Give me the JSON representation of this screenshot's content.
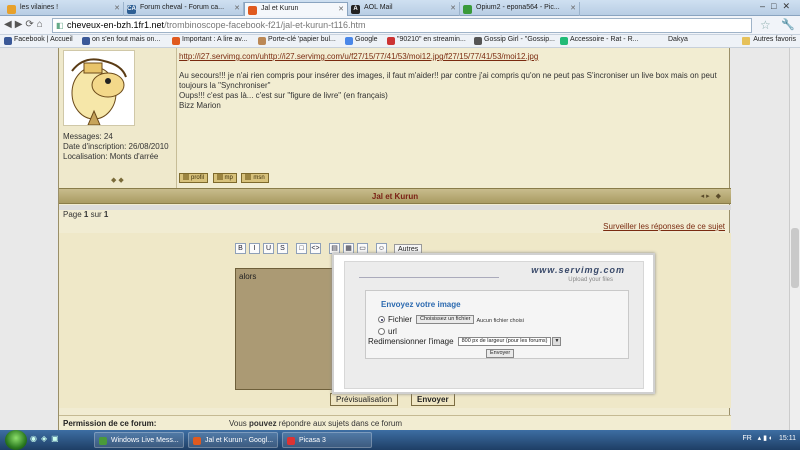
{
  "browser": {
    "tabs": [
      {
        "label": "les vilaines !",
        "icon": "ball-icon",
        "color": "#e7a12b",
        "active": false
      },
      {
        "label": "Forum cheval - Forum ca...",
        "icon": "ca-icon",
        "color": "#2e5f94",
        "active": false
      },
      {
        "label": "Jal et Kurun",
        "icon": "forum-icon",
        "color": "#e05a1f",
        "active": true
      },
      {
        "label": "AOL Mail",
        "icon": "aol-icon",
        "color": "#222222",
        "active": false
      },
      {
        "label": "Opium2 - epona564 - Pic...",
        "icon": "picasa-icon",
        "color": "#3a9a3a",
        "active": false
      }
    ],
    "address": {
      "host": "cheveux-en-bzh.1fr1.net",
      "path": "/trombinoscope-facebook-f21/jal-et-kurun-t116.htm"
    },
    "bookmarks": [
      {
        "label": "Facebook | Accueil",
        "color": "#3b5998"
      },
      {
        "label": "on s'en fout mais on...",
        "color": "#3b5998"
      },
      {
        "label": "Important : A lire av...",
        "color": "#e05a1f"
      },
      {
        "label": "Porte-clé 'papier bul...",
        "color": "#b85"
      },
      {
        "label": "Google",
        "color": "#4a87e8"
      },
      {
        "label": "\"90210\" en streamin...",
        "color": "#c33"
      },
      {
        "label": "Gossip Girl - \"Gossip...",
        "color": "#555"
      },
      {
        "label": "Accessoire - Rat - R...",
        "color": "#2b7"
      },
      {
        "label": "Dakya",
        "color": "#eee"
      }
    ],
    "other_bookmarks": "Autres favoris"
  },
  "post": {
    "author_info": {
      "messages": "Messages: 24",
      "date": "Date d'inscription: 26/08/2010",
      "location": "Localisation: Monts d'arrée"
    },
    "link": "http://i27.servimg.com/uhttp://i27.servimg.com/u/f27/15/77/41/53/moi12.jpg/f27/15/77/41/53/moi12.jpg",
    "paragraph1": "Au secours!!! je n'ai rien compris pour insérer des images, il faut m'aider!! par contre j'ai compris qu'on ne peut pas S'incroniser un live box mais on peut toujours la \"Synchroniser\"",
    "paragraph2": "Oups!!! c'est pas là... c'est sur \"figure de livre\" (en français)",
    "signature": "Bizz Marion",
    "buttons": [
      "profil",
      "mp",
      "msn"
    ]
  },
  "topic": {
    "title": "Jal et Kurun",
    "pager_prefix": "Page ",
    "pager_current": "1",
    "pager_mid": " sur ",
    "pager_total": "1",
    "watch": "Surveiller les réponses de ce sujet"
  },
  "editor": {
    "toolbar": [
      "B",
      "I",
      "U",
      "S",
      "□",
      "<>",
      "▤",
      "▦",
      "▭",
      "☺"
    ],
    "autres": "Autres",
    "text": "alors",
    "preview": "Prévisualisation",
    "send": "Envoyer"
  },
  "permission": {
    "label": "Permission de ce forum:",
    "text_pre": "Vous ",
    "text_bold": "pouvez",
    "text_post": " répondre aux sujets dans ce forum"
  },
  "servimg": {
    "logo": "www.servimg.com",
    "tagline": "Upload your files",
    "heading": "Envoyez votre image",
    "file_label": "Fichier",
    "choose_btn": "Choisissez un fichier",
    "no_file": "Aucun fichier choisi",
    "url_label": "url",
    "resize_label": "Redimensionner l'image",
    "resize_value": "800 px de largeur (pour les forums)",
    "send": "Envoyer"
  },
  "taskbar": {
    "tasks": [
      {
        "label": "Windows Live Mess...",
        "color": "#4a9a3a"
      },
      {
        "label": "Jal et Kurun - Googl...",
        "color": "#e05a1f"
      },
      {
        "label": "Picasa 3",
        "color": "#d33"
      }
    ],
    "lang": "FR",
    "time": "15:11"
  }
}
